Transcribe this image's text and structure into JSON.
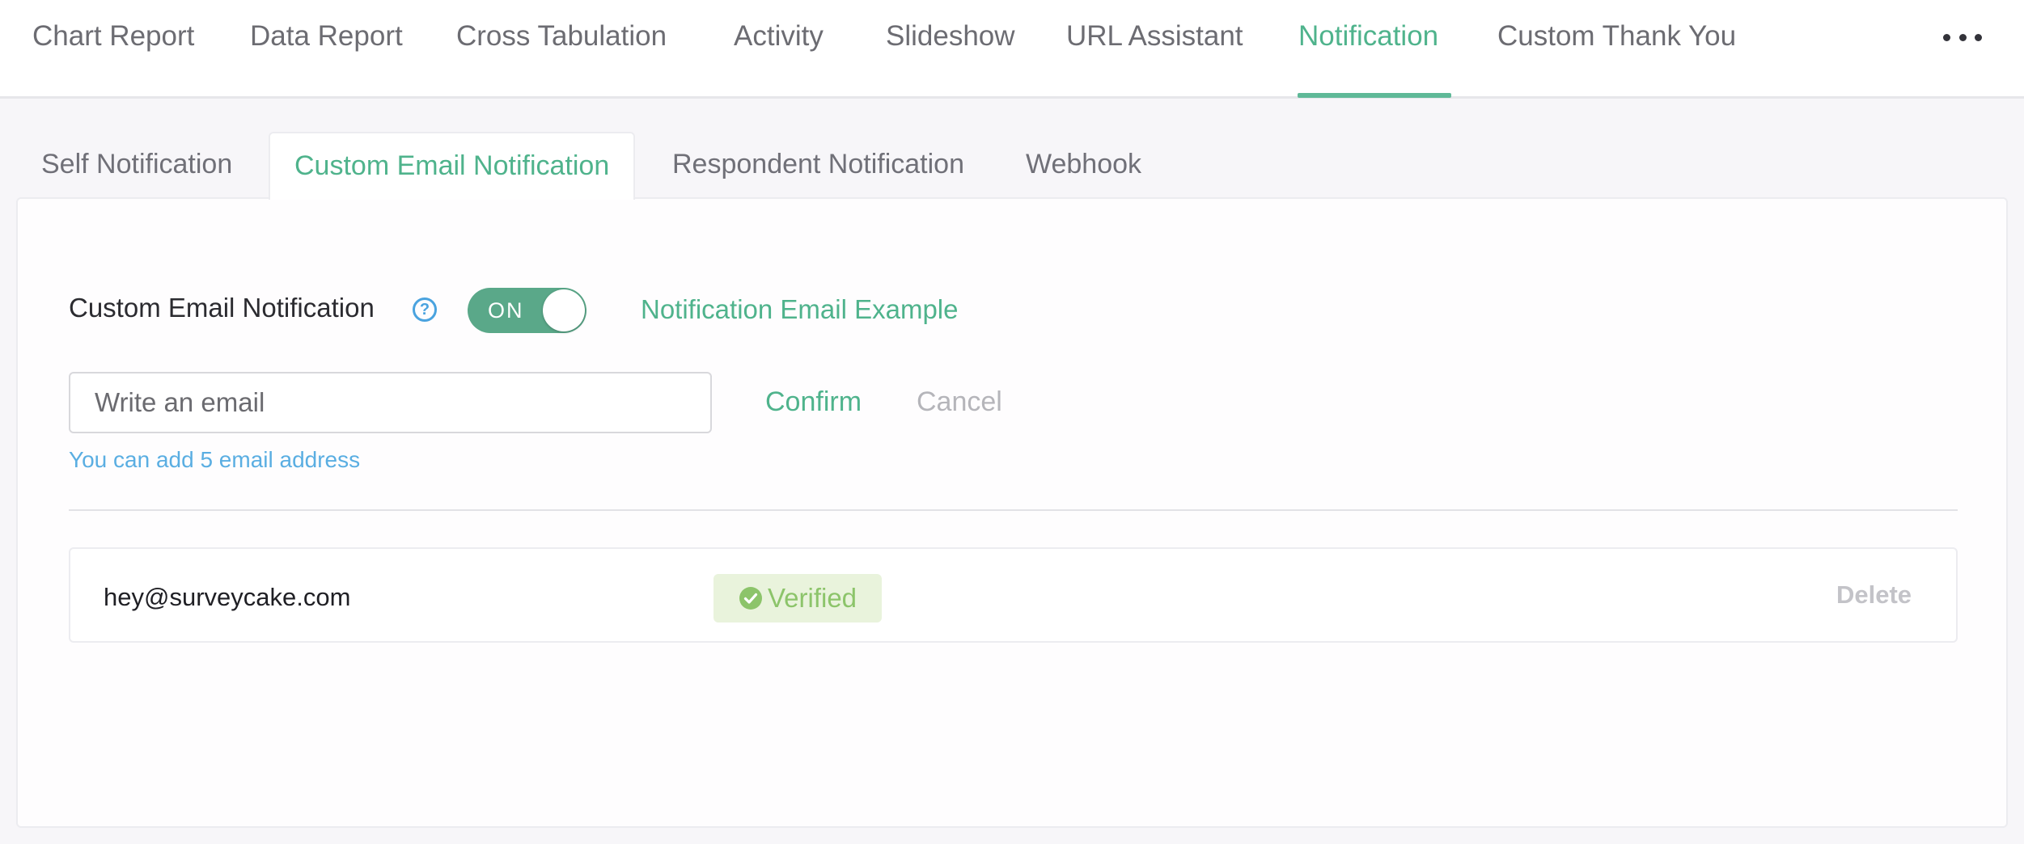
{
  "topnav": {
    "items": [
      {
        "label": "Chart Report"
      },
      {
        "label": "Data Report"
      },
      {
        "label": "Cross Tabulation"
      },
      {
        "label": "Activity"
      },
      {
        "label": "Slideshow"
      },
      {
        "label": "URL Assistant"
      },
      {
        "label": "Notification",
        "active": true
      },
      {
        "label": "Custom Thank You"
      }
    ],
    "more_icon": "more-horizontal-icon"
  },
  "subtabs": [
    {
      "label": "Self Notification"
    },
    {
      "label": "Custom Email Notification",
      "active": true
    },
    {
      "label": "Respondent Notification"
    },
    {
      "label": "Webhook"
    }
  ],
  "settings": {
    "label": "Custom Email Notification",
    "help_icon": "?",
    "toggle_label": "ON",
    "toggle_on": true,
    "example_link": "Notification Email Example",
    "email_placeholder": "Write an email",
    "confirm": "Confirm",
    "cancel": "Cancel",
    "hint": "You can add 5 email address"
  },
  "emails": [
    {
      "address": "hey@surveycake.com",
      "status": "Verified",
      "delete": "Delete"
    }
  ],
  "colors": {
    "accent": "#4fb38c",
    "toggle": "#5aa889",
    "hint": "#5aaee2",
    "verified_bg": "#e9f3dc",
    "verified_text": "#8cc46a"
  }
}
